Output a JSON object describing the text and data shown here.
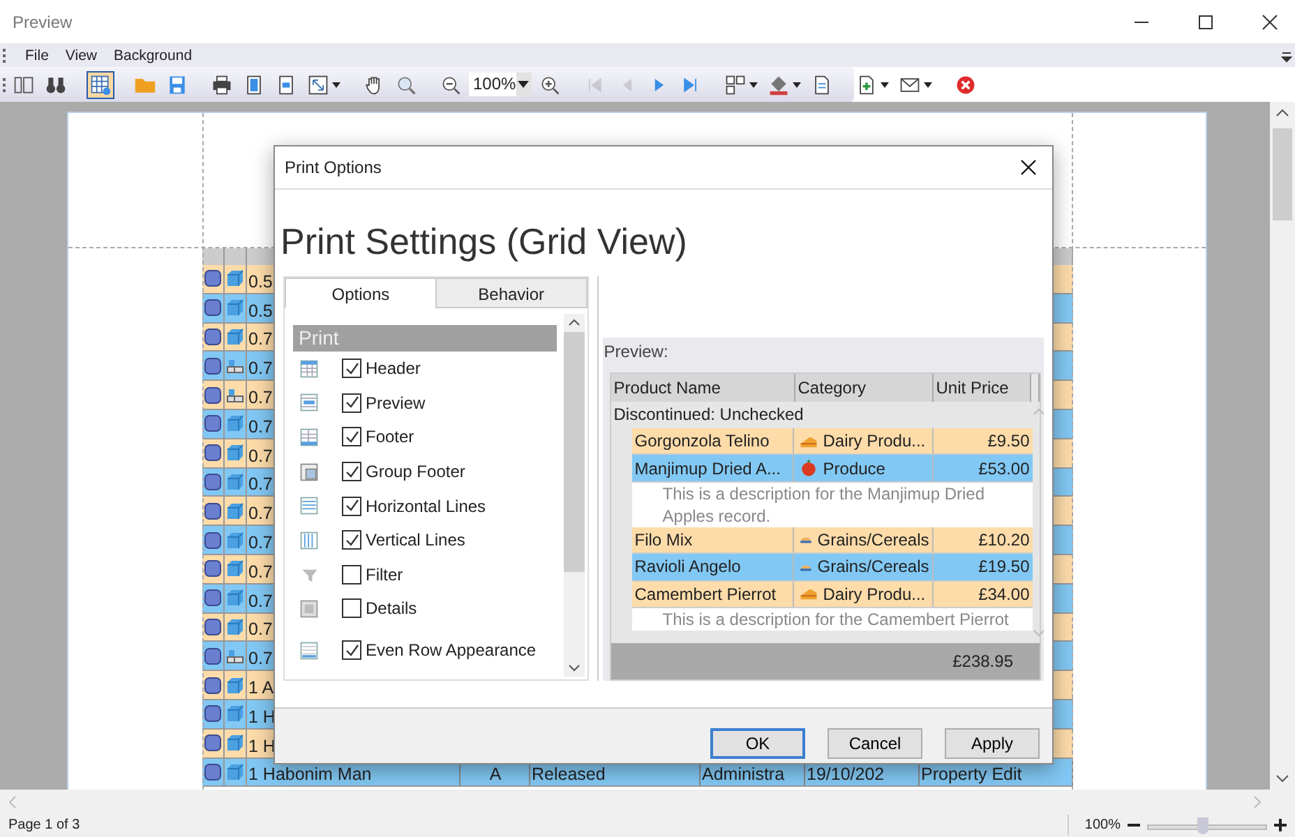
{
  "window": {
    "title": "Preview"
  },
  "menu": [
    "File",
    "View",
    "Background"
  ],
  "toolbar": {
    "groups": [
      [
        {
          "kind": "button",
          "selected": false,
          "disabled": false,
          "dropdown": false
        },
        {
          "kind": "button",
          "selected": false,
          "disabled": false,
          "dropdown": false
        }
      ],
      [
        {
          "kind": "button",
          "selected": true,
          "disabled": false,
          "dropdown": false
        }
      ],
      [
        {
          "kind": "button",
          "selected": false,
          "disabled": false,
          "dropdown": false
        },
        {
          "kind": "button",
          "selected": false,
          "disabled": false,
          "dropdown": false
        }
      ],
      [
        {
          "kind": "button",
          "selected": false,
          "disabled": false,
          "dropdown": false
        },
        {
          "kind": "button",
          "selected": false,
          "disabled": false,
          "dropdown": false
        },
        {
          "kind": "button",
          "selected": false,
          "disabled": false,
          "dropdown": false
        },
        {
          "kind": "button",
          "selected": false,
          "disabled": false,
          "dropdown": true
        }
      ],
      [
        {
          "kind": "button",
          "selected": false,
          "disabled": false,
          "dropdown": false
        },
        {
          "kind": "button",
          "selected": false,
          "disabled": false,
          "dropdown": false
        }
      ],
      [
        {
          "kind": "button",
          "selected": false,
          "disabled": false,
          "dropdown": false
        },
        {
          "kind": "combo",
          "value": "100%"
        },
        {
          "kind": "button",
          "selected": false,
          "disabled": false,
          "dropdown": false
        }
      ],
      [
        {
          "kind": "button",
          "selected": false,
          "disabled": true,
          "dropdown": false
        },
        {
          "kind": "button",
          "selected": false,
          "disabled": true,
          "dropdown": false
        },
        {
          "kind": "button",
          "selected": false,
          "disabled": false,
          "dropdown": false
        },
        {
          "kind": "button",
          "selected": false,
          "disabled": false,
          "dropdown": false
        }
      ],
      [
        {
          "kind": "button",
          "selected": false,
          "disabled": false,
          "dropdown": true
        },
        {
          "kind": "button",
          "selected": false,
          "disabled": false,
          "dropdown": true
        },
        {
          "kind": "button",
          "selected": false,
          "disabled": false,
          "dropdown": false
        }
      ],
      [
        {
          "kind": "button",
          "selected": false,
          "disabled": false,
          "dropdown": true
        },
        {
          "kind": "button",
          "selected": false,
          "disabled": false,
          "dropdown": true
        }
      ],
      [
        {
          "kind": "button",
          "selected": false,
          "disabled": false,
          "dropdown": false
        }
      ]
    ]
  },
  "document": {
    "rows": [
      {
        "kind": "part",
        "cells": [
          "0.5"
        ]
      },
      {
        "kind": "part",
        "cells": [
          "0.5"
        ]
      },
      {
        "kind": "part",
        "cells": [
          "0.7"
        ]
      },
      {
        "kind": "assembly",
        "cells": [
          "0.7"
        ]
      },
      {
        "kind": "assembly",
        "cells": [
          "0.7"
        ]
      },
      {
        "kind": "part",
        "cells": [
          "0.7"
        ]
      },
      {
        "kind": "part",
        "cells": [
          "0.7"
        ]
      },
      {
        "kind": "part",
        "cells": [
          "0.7"
        ]
      },
      {
        "kind": "part",
        "cells": [
          "0.7"
        ]
      },
      {
        "kind": "part",
        "cells": [
          "0.7"
        ]
      },
      {
        "kind": "part",
        "cells": [
          "0.7"
        ]
      },
      {
        "kind": "part",
        "cells": [
          "0.7"
        ]
      },
      {
        "kind": "part",
        "cells": [
          "0.7"
        ]
      },
      {
        "kind": "assembly",
        "cells": [
          "0.7"
        ]
      },
      {
        "kind": "part",
        "cells": [
          "1 A"
        ]
      },
      {
        "kind": "part",
        "cells": [
          "1 H"
        ]
      },
      {
        "kind": "part",
        "cells": [
          "1 H"
        ]
      },
      {
        "kind": "part",
        "cells": [
          "1 Habonim Man",
          "A",
          "Released",
          "Administra",
          "19/10/202",
          "Property Edit"
        ]
      }
    ]
  },
  "dialog": {
    "title": "Print Options",
    "heading": "Print Settings (Grid View)",
    "tabs": [
      {
        "label": "Options",
        "selected": true
      },
      {
        "label": "Behavior",
        "selected": false
      }
    ],
    "section": "Print",
    "options": [
      {
        "label": "Header",
        "checked": true
      },
      {
        "label": "Preview",
        "checked": true
      },
      {
        "label": "Footer",
        "checked": true
      },
      {
        "label": "Group Footer",
        "checked": true
      },
      {
        "label": "Horizontal Lines",
        "checked": true
      },
      {
        "label": "Vertical Lines",
        "checked": true
      },
      {
        "label": "Filter",
        "checked": false
      },
      {
        "label": "Details",
        "checked": false
      },
      {
        "label": "Even Row Appearance",
        "checked": true
      }
    ],
    "preview": {
      "label": "Preview:",
      "columns": [
        "Product Name",
        "Category",
        "Unit Price"
      ],
      "group": "Discontinued: Unchecked",
      "rows": [
        {
          "kind": "dairy",
          "name": "Gorgonzola Telino",
          "category": "Dairy Produ...",
          "price": "£9.50"
        },
        {
          "kind": "produce",
          "name": "Manjimup Dried A...",
          "category": "Produce",
          "price": "£53.00",
          "description": "This is a description for the Manjimup Dried Apples record."
        },
        {
          "kind": "grains",
          "name": "Filo Mix",
          "category": "Grains/Cereals",
          "price": "£10.20"
        },
        {
          "kind": "grains",
          "name": "Ravioli Angelo",
          "category": "Grains/Cereals",
          "price": "£19.50"
        },
        {
          "kind": "dairy",
          "name": "Camembert Pierrot",
          "category": "Dairy Produ...",
          "price": "£34.00",
          "description": "This is a description for the Camembert Pierrot"
        }
      ],
      "total": "£238.95"
    },
    "buttons": [
      "OK",
      "Cancel",
      "Apply"
    ]
  },
  "status_bar": {
    "page": "Page 1 of 3",
    "zoom": "100%",
    "zoom_slider": {
      "level": 0.47
    }
  }
}
